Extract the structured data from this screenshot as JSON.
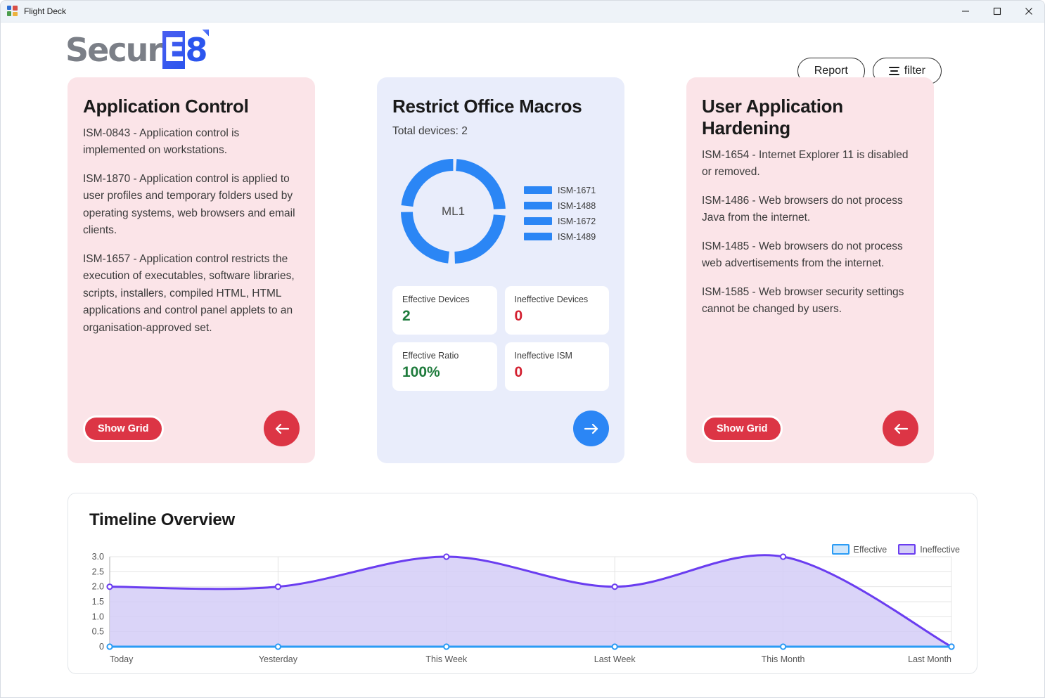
{
  "window": {
    "title": "Flight Deck",
    "icon": "app-icon",
    "controls": {
      "minimize": "minimize",
      "maximize": "maximize",
      "close": "close"
    }
  },
  "header": {
    "logo": {
      "part1": "Secur",
      "part2": "E",
      "part3": "8"
    },
    "report_label": "Report",
    "filter_label": "filter"
  },
  "cards": [
    {
      "title": "Application Control",
      "theme": "pink",
      "paragraphs": [
        "ISM-0843 - Application control is implemented on workstations.",
        "ISM-1870 - Application control is applied to user profiles and temporary folders used by operating systems, web browsers and email clients.",
        "ISM-1657 - Application control restricts the execution of executables, software libraries, scripts, installers, compiled HTML, HTML applications and control panel applets to an organisation-approved set."
      ],
      "show_grid_label": "Show Grid",
      "nav_direction": "left"
    },
    {
      "title": "User Application Hardening",
      "theme": "pink",
      "paragraphs": [
        "ISM-1654 - Internet Explorer 11 is disabled or removed.",
        "ISM-1486 - Web browsers do not process Java from the internet.",
        "ISM-1485 - Web browsers do not process web advertisements from the internet.",
        "ISM-1585 - Web browser security settings cannot be changed by users."
      ],
      "show_grid_label": "Show Grid",
      "nav_direction": "left"
    }
  ],
  "center_card": {
    "title": "Restrict Office Macros",
    "total_devices": "Total devices: 2",
    "donut_center_label": "ML1",
    "nav_direction": "right",
    "legend": [
      {
        "label": "ISM-1671",
        "color": "#2b86f5"
      },
      {
        "label": "ISM-1488",
        "color": "#2b86f5"
      },
      {
        "label": "ISM-1672",
        "color": "#2b86f5"
      },
      {
        "label": "ISM-1489",
        "color": "#2b86f5"
      }
    ],
    "stats": [
      {
        "label": "Effective Devices",
        "value": "2",
        "tone": "green"
      },
      {
        "label": "Ineffective Devices",
        "value": "0",
        "tone": "red"
      },
      {
        "label": "Effective Ratio",
        "value": "100%",
        "tone": "green"
      },
      {
        "label": "Ineffective ISM",
        "value": "0",
        "tone": "red"
      }
    ]
  },
  "timeline": {
    "title": "Timeline Overview"
  },
  "chart_data": {
    "type": "area",
    "title": "Timeline Overview",
    "xlabel": "",
    "ylabel": "",
    "categories": [
      "Today",
      "Yesterday",
      "This Week",
      "Last Week",
      "This Month",
      "Last Month"
    ],
    "yticks": [
      "0",
      "0.5",
      "1.0",
      "1.5",
      "2.0",
      "2.5",
      "3.0"
    ],
    "ylim": [
      0,
      3
    ],
    "grid": true,
    "legend_position": "top-right",
    "series": [
      {
        "name": "Effective",
        "values": [
          0,
          0,
          0,
          0,
          0,
          0
        ],
        "color": "#2b9cf5",
        "fill": "#cfe6fb"
      },
      {
        "name": "Ineffective",
        "values": [
          2,
          2,
          3,
          2,
          3,
          0
        ],
        "color": "#6a3df0",
        "fill": "#d4cdf7"
      }
    ]
  },
  "colors": {
    "pink_card": "#fbe4e8",
    "blue_card": "#e9edfb",
    "accent_red": "#dc3545",
    "accent_blue": "#2b86f5",
    "green": "#1e7b3c",
    "red": "#d32030",
    "purple": "#6a3df0"
  }
}
